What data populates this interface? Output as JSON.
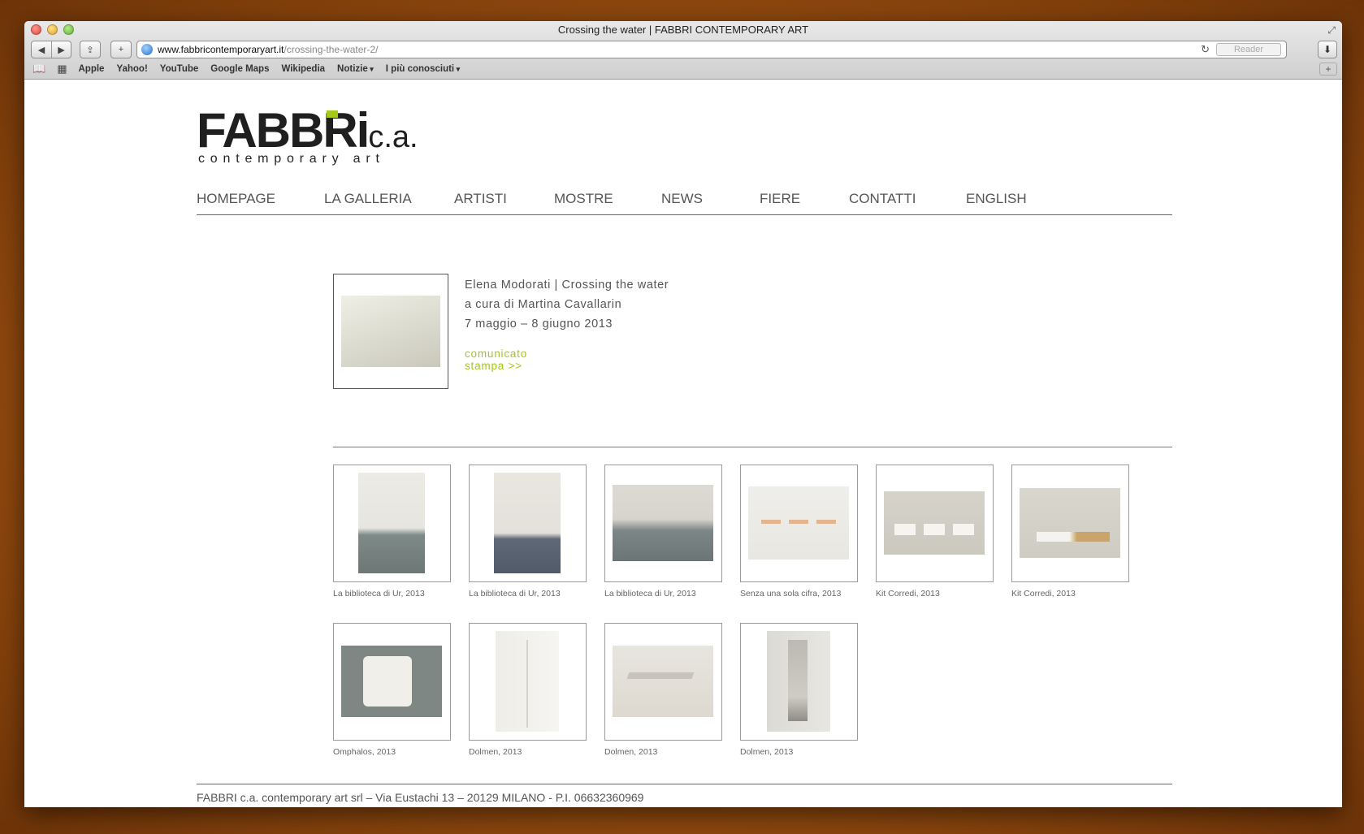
{
  "browser": {
    "window_title": "Crossing the water | FABBRI CONTEMPORARY ART",
    "url_host": "www.fabbricontemporaryart.it",
    "url_path": "/crossing-the-water-2/",
    "reader_label": "Reader",
    "bookmarks": [
      "Apple",
      "Yahoo!",
      "YouTube",
      "Google Maps",
      "Wikipedia",
      "Notizie",
      "I più conosciuti"
    ]
  },
  "site": {
    "logo_main": "FABBRi",
    "logo_ca": "c.a.",
    "logo_sub": "contemporary art",
    "accent_color": "#a5c81a",
    "menu": [
      "HOMEPAGE",
      "LA GALLERIA",
      "ARTISTI",
      "MOSTRE",
      "NEWS",
      "FIERE",
      "CONTATTI",
      "ENGLISH"
    ]
  },
  "exhibition": {
    "line1": "Elena Modorati | Crossing the water",
    "line2": "a cura di Martina Cavallarin",
    "line3": "7 maggio – 8 giugno 2013",
    "press_link": "comunicato stampa >>"
  },
  "gallery": [
    {
      "caption": "La biblioteca di Ur, 2013"
    },
    {
      "caption": "La biblioteca di Ur, 2013"
    },
    {
      "caption": "La biblioteca di Ur, 2013"
    },
    {
      "caption": "Senza una sola cifra, 2013"
    },
    {
      "caption": "Kit Corredi, 2013"
    },
    {
      "caption": "Kit Corredi, 2013"
    },
    {
      "caption": "Omphalos, 2013"
    },
    {
      "caption": "Dolmen, 2013"
    },
    {
      "caption": "Dolmen, 2013"
    },
    {
      "caption": "Dolmen, 2013"
    }
  ],
  "footer": "FABBRI c.a. contemporary art srl – Via Eustachi 13 – 20129 MILANO - P.I. 06632360969"
}
